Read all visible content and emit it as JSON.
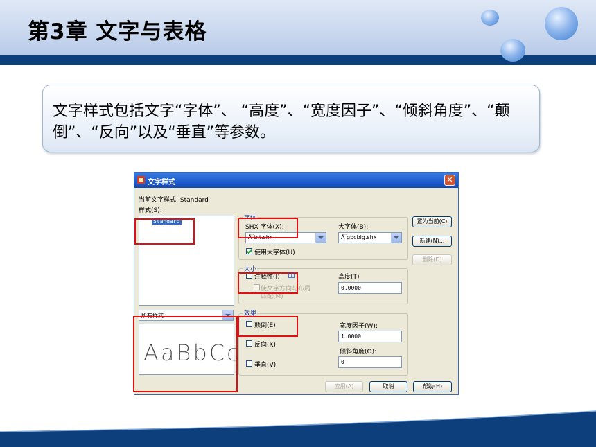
{
  "slide": {
    "title": "第3章  文字与表格",
    "callout_text": "文字样式包括文字“字体”、 “高度”、“宽度因子”、“倾斜角度”、“颠倒”、“反向”以及“垂直”等参数。"
  },
  "dialog": {
    "title": "文字样式",
    "close_label": "✕",
    "current_style_label": "当前文字样式:  Standard",
    "styles_label": "样式(S):",
    "styles_list": [
      "Standard"
    ],
    "filter_value": "所有样式",
    "preview_text": "AaBbCc",
    "font_group_label": "字体",
    "shx_font_label": "SHX 字体(X):",
    "shx_font_value": "txt.shx",
    "big_font_label": "大字体(B):",
    "big_font_value": "gbcbig.shx",
    "use_big_font_label": "使用大字体(U)",
    "use_big_font_checked": true,
    "size_group_label": "大小",
    "annotative_label": "注释性(I)",
    "annotative_checked": false,
    "match_orientation_label": "使文字方向与布局",
    "match_orientation_label2": "匹配(M)",
    "height_label": "高度(T)",
    "height_value": "0.0000",
    "effects_group_label": "效果",
    "upside_down_label": "颠倒(E)",
    "upside_down_checked": false,
    "backwards_label": "反向(K)",
    "backwards_checked": false,
    "vertical_label": "垂直(V)",
    "vertical_checked": false,
    "width_factor_label": "宽度因子(W):",
    "width_factor_value": "1.0000",
    "oblique_label": "倾斜角度(O):",
    "oblique_value": "0",
    "set_current_label": "置为当前(C)",
    "new_label": "新建(N)...",
    "delete_label": "删除(D)",
    "apply_label": "应用(A)",
    "cancel_label": "取消",
    "help_label": "帮助(H)"
  },
  "colors": {
    "header_bar": "#0d3f7c",
    "highlight": "#e01010",
    "titlebar": "#1d5ccf"
  }
}
